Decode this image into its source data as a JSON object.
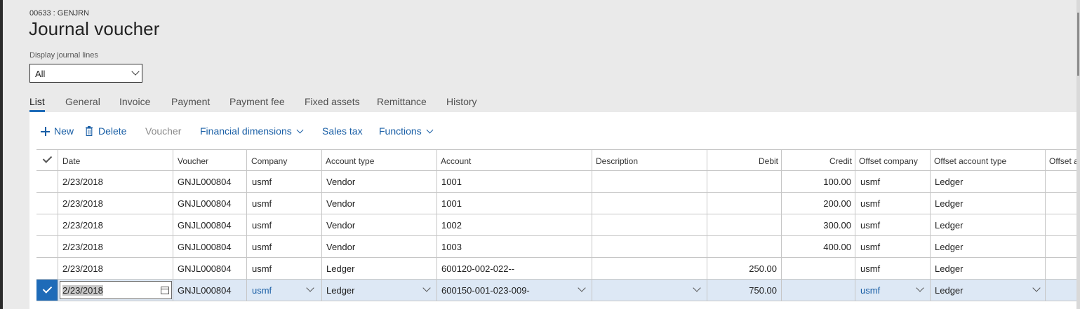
{
  "page": {
    "caption": "00633 : GENJRN",
    "title": "Journal voucher"
  },
  "filter": {
    "label": "Display journal lines",
    "value": "All"
  },
  "tabs": [
    "List",
    "General",
    "Invoice",
    "Payment",
    "Payment fee",
    "Fixed assets",
    "Remittance",
    "History"
  ],
  "active_tab": "List",
  "actions": {
    "new": "New",
    "delete": "Delete",
    "voucher": "Voucher",
    "financial_dimensions": "Financial dimensions",
    "sales_tax": "Sales tax",
    "functions": "Functions"
  },
  "columns": {
    "date": "Date",
    "voucher": "Voucher",
    "company": "Company",
    "account_type": "Account type",
    "account": "Account",
    "description": "Description",
    "debit": "Debit",
    "credit": "Credit",
    "offset_company": "Offset company",
    "offset_account_type": "Offset account type",
    "offset_account": "Offset ac"
  },
  "rows": [
    {
      "date": "2/23/2018",
      "voucher": "GNJL000804",
      "company": "usmf",
      "account_type": "Vendor",
      "account": "1001",
      "description": "",
      "debit": "",
      "credit": "100.00",
      "offset_company": "usmf",
      "offset_account_type": "Ledger"
    },
    {
      "date": "2/23/2018",
      "voucher": "GNJL000804",
      "company": "usmf",
      "account_type": "Vendor",
      "account": "1001",
      "description": "",
      "debit": "",
      "credit": "200.00",
      "offset_company": "usmf",
      "offset_account_type": "Ledger"
    },
    {
      "date": "2/23/2018",
      "voucher": "GNJL000804",
      "company": "usmf",
      "account_type": "Vendor",
      "account": "1002",
      "description": "",
      "debit": "",
      "credit": "300.00",
      "offset_company": "usmf",
      "offset_account_type": "Ledger"
    },
    {
      "date": "2/23/2018",
      "voucher": "GNJL000804",
      "company": "usmf",
      "account_type": "Vendor",
      "account": "1003",
      "description": "",
      "debit": "",
      "credit": "400.00",
      "offset_company": "usmf",
      "offset_account_type": "Ledger"
    },
    {
      "date": "2/23/2018",
      "voucher": "GNJL000804",
      "company": "usmf",
      "account_type": "Ledger",
      "account": "600120-002-022--",
      "description": "",
      "debit": "250.00",
      "credit": "",
      "offset_company": "usmf",
      "offset_account_type": "Ledger"
    },
    {
      "date": "2/23/2018",
      "voucher": "GNJL000804",
      "company": "usmf",
      "account_type": "Ledger",
      "account": "600150-001-023-009-",
      "description": "",
      "debit": "750.00",
      "credit": "",
      "offset_company": "usmf",
      "offset_account_type": "Ledger"
    }
  ],
  "colors": {
    "accent": "#1e6bb8",
    "link": "#1a5fa6",
    "selected_row": "#dde8f5",
    "background": "#eaeaea"
  }
}
